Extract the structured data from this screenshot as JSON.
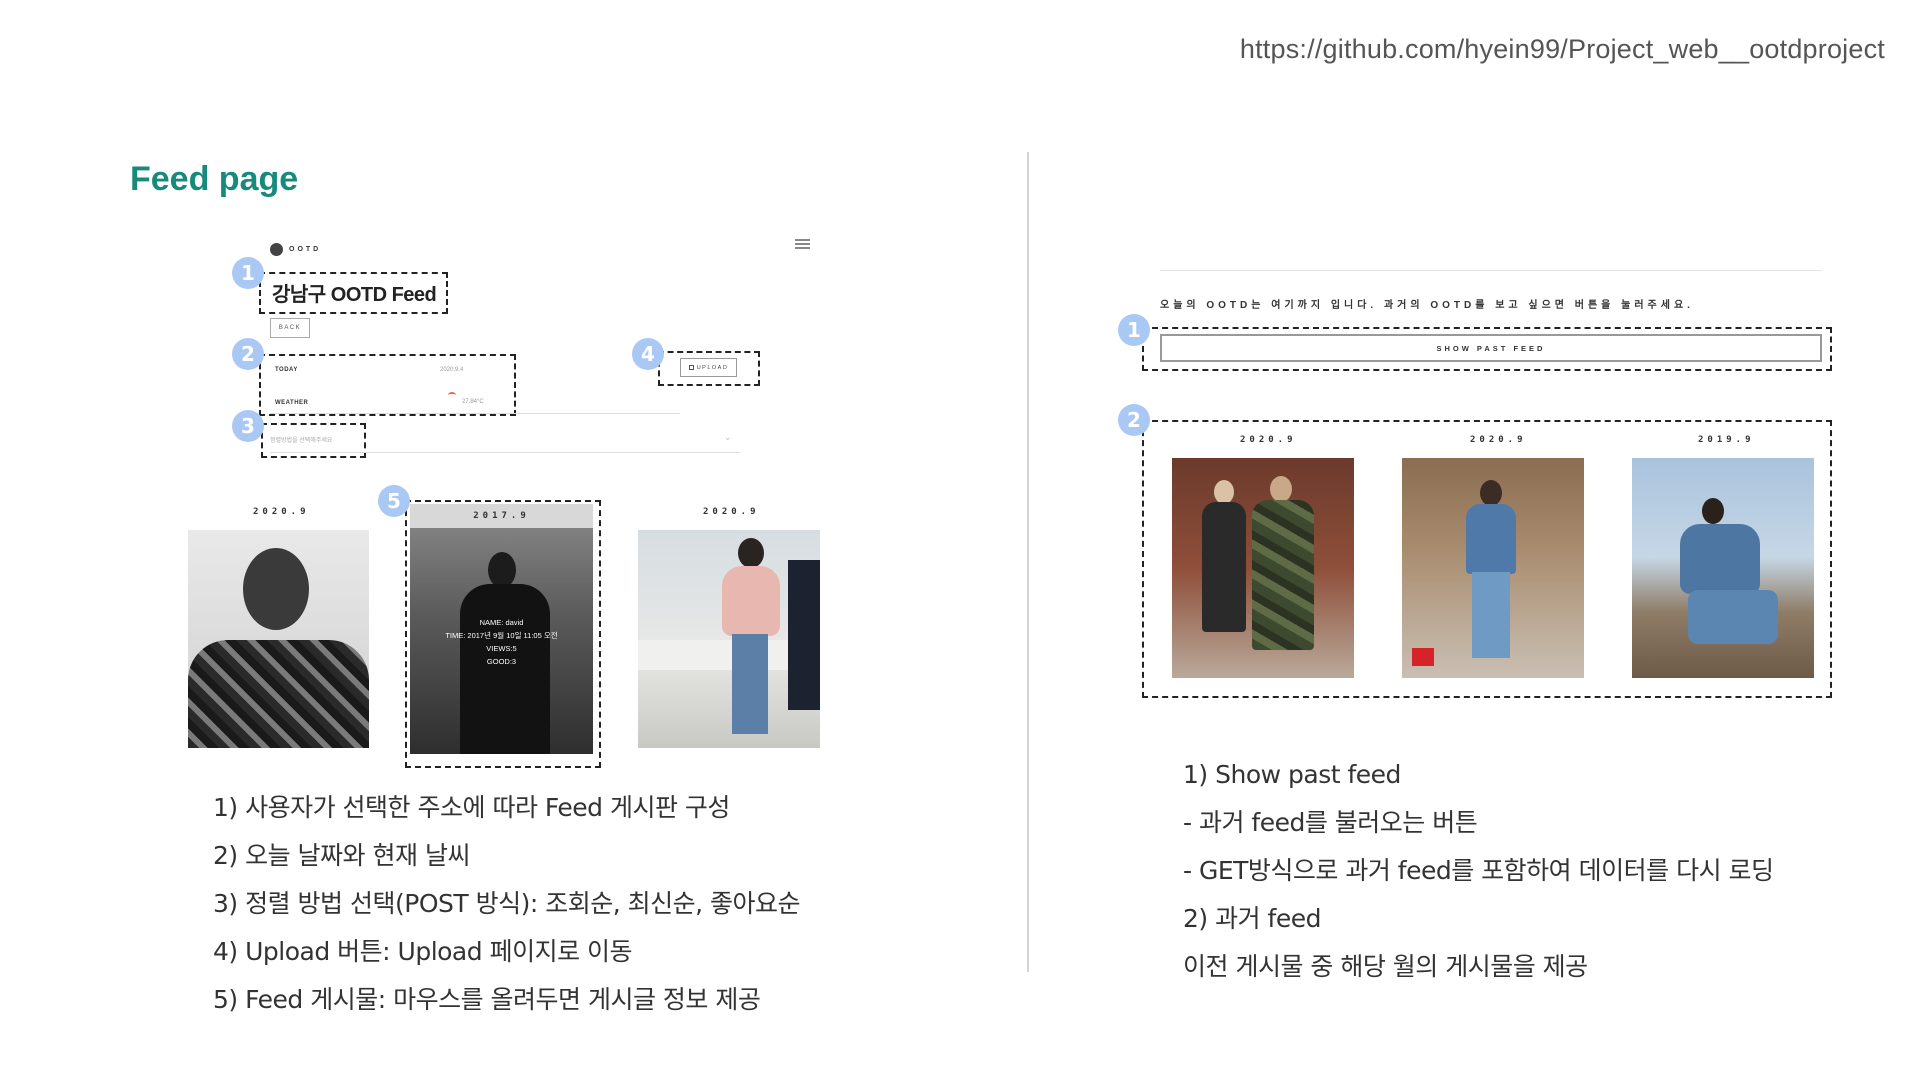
{
  "url": "https://github.com/hyein99/Project_web__ootdproject",
  "section_title": "Feed page",
  "left_mockup": {
    "logo_text": "OOTD",
    "feed_title": "강남구 OOTD Feed",
    "back_label": "BACK",
    "today_label": "TODAY",
    "today_value": "2020.9.4",
    "weather_label": "WEATHER",
    "weather_value": "27.84°C",
    "upload_label": "UPLOAD",
    "sort_placeholder": "정렬방법을 선택해주세요",
    "badges": [
      "1",
      "2",
      "3",
      "4",
      "5"
    ],
    "posts": [
      {
        "date": "2020.9"
      },
      {
        "date": "2017.9",
        "overlay": [
          "NAME: david",
          "TIME: 2017년 9월 10일 11:05 오전",
          "VIEWS:5",
          "GOOD:3"
        ]
      },
      {
        "date": "2020.9"
      }
    ]
  },
  "right_mockup": {
    "message": "오늘의 OOTD는 여기까지 입니다. 과거의 OOTD를 보고 싶으면 버튼을 눌러주세요.",
    "past_button": "SHOW PAST FEED",
    "badges": [
      "1",
      "2"
    ],
    "posts": [
      {
        "date": "2020.9"
      },
      {
        "date": "2020.9"
      },
      {
        "date": "2019.9"
      }
    ]
  },
  "left_description": [
    "1) 사용자가 선택한 주소에 따라 Feed 게시판 구성",
    "2) 오늘 날짜와 현재 날씨",
    "3) 정렬 방법 선택(POST 방식): 조회순, 최신순, 좋아요순",
    "4) Upload 버튼: Upload 페이지로 이동",
    "5) Feed 게시물: 마우스를 올려두면 게시글 정보 제공"
  ],
  "right_description": [
    "1) Show past feed",
    "- 과거 feed를 불러오는 버튼",
    "- GET방식으로 과거 feed를 포함하여 데이터를 다시 로딩",
    "2) 과거 feed",
    "이전 게시물 중 해당 월의 게시물을 제공"
  ],
  "colors": {
    "title": "#178a7c",
    "badge": "#a9c8f3"
  }
}
